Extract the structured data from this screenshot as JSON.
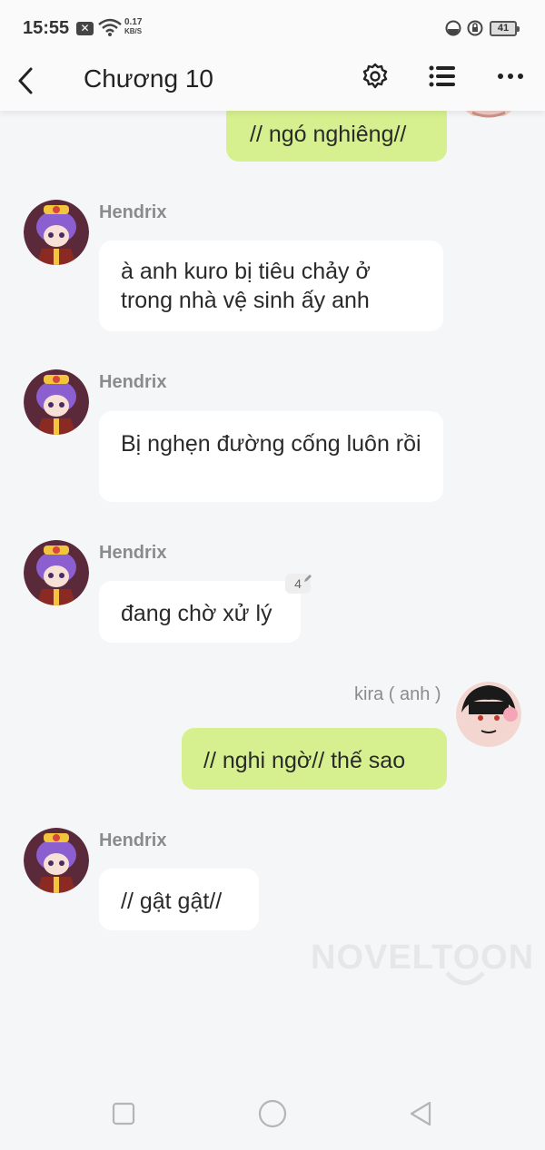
{
  "status_bar": {
    "time": "15:55",
    "notif_icon": "x-notification-icon",
    "net_speed_value": "0.17",
    "net_speed_unit": "KB/S",
    "battery": "41"
  },
  "header": {
    "title": "Chương 10",
    "back_icon": "back-arrow-icon",
    "settings_icon": "gear-icon",
    "list_icon": "list-icon",
    "more_icon": "more-dots-icon"
  },
  "messages": [
    {
      "sender": "",
      "side": "right",
      "text": "// ngó nghiêng//"
    },
    {
      "sender": "Hendrix",
      "side": "left",
      "text": "à anh kuro bị tiêu chảy ở trong nhà vệ sinh ấy anh"
    },
    {
      "sender": "Hendrix",
      "side": "left",
      "text": "Bị nghẹn đường cống luôn rồi"
    },
    {
      "sender": "Hendrix",
      "side": "left",
      "text": "đang chờ xử lý",
      "comment_count": "4"
    },
    {
      "sender": "kira ( anh )",
      "side": "right",
      "text": "// nghi ngờ// thế sao"
    },
    {
      "sender": "Hendrix",
      "side": "left",
      "text": "// gật gật//"
    }
  ],
  "watermark": "NOVELTOON",
  "colors": {
    "green_bubble": "#d6f08f",
    "white_bubble": "#ffffff",
    "background": "#f5f6f8",
    "name_gray": "#8b8b8b"
  },
  "nav_bar": {
    "recents_icon": "square-recents-icon",
    "home_icon": "circle-home-icon",
    "back_icon": "triangle-back-icon"
  }
}
